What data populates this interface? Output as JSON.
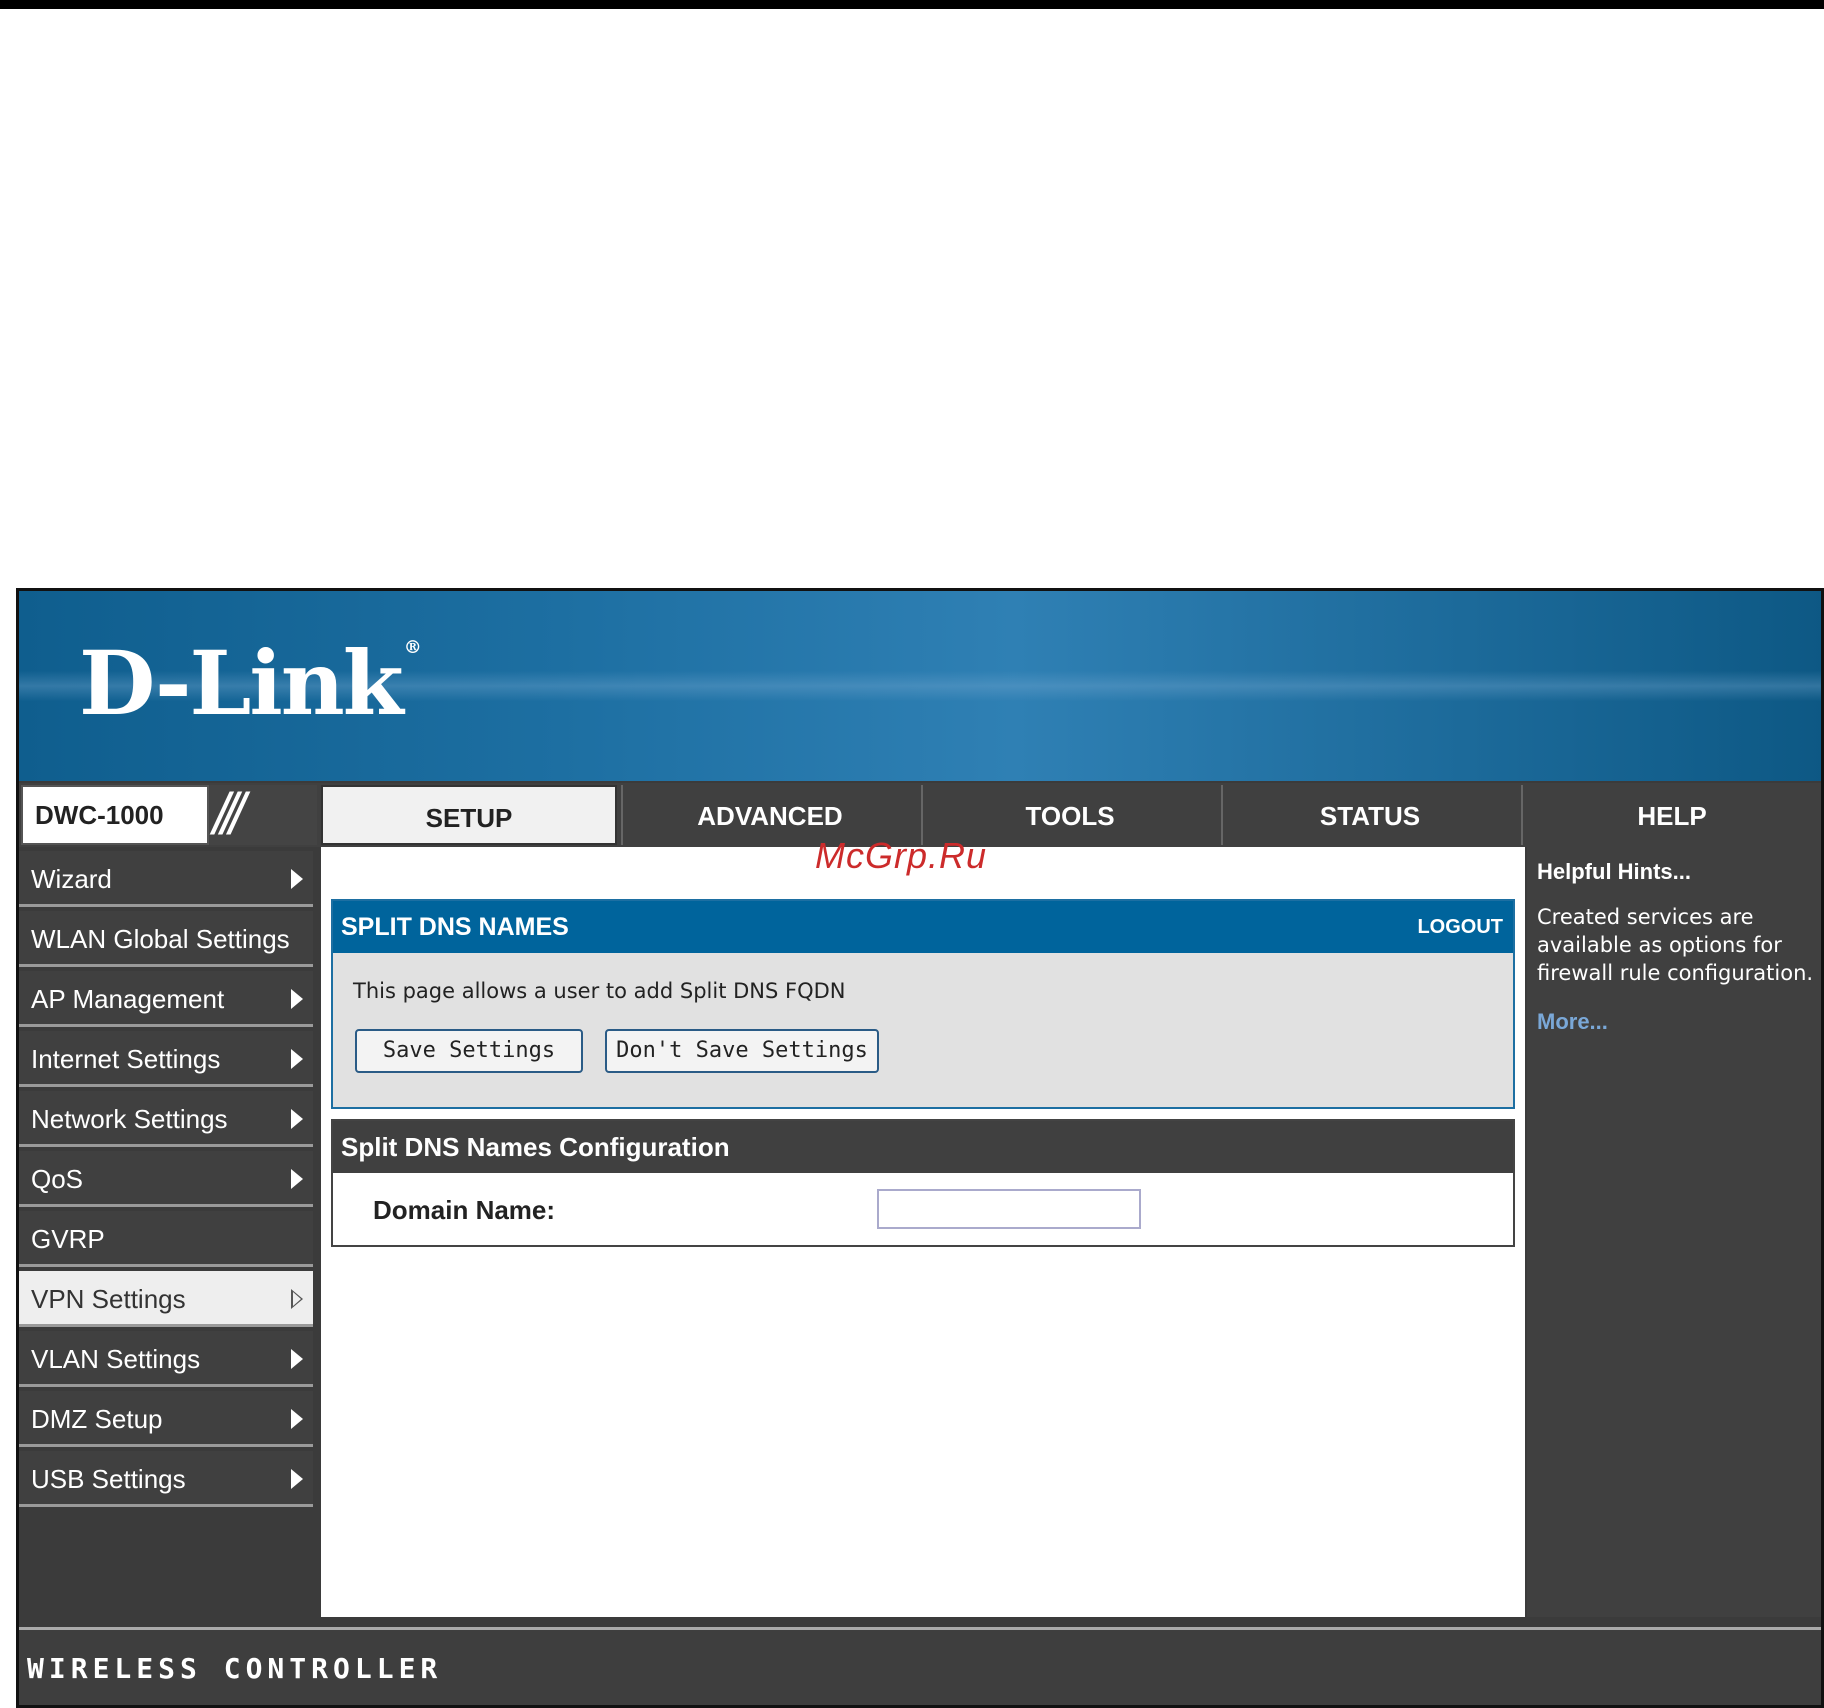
{
  "brand": {
    "logo_text": "D-Link",
    "registered": "®"
  },
  "header": {
    "model": "DWC-1000"
  },
  "tabs": [
    {
      "label": "SETUP"
    },
    {
      "label": "ADVANCED"
    },
    {
      "label": "TOOLS"
    },
    {
      "label": "STATUS"
    },
    {
      "label": "HELP"
    }
  ],
  "sidebar": {
    "items": [
      {
        "label": "Wizard"
      },
      {
        "label": "WLAN Global Settings"
      },
      {
        "label": "AP Management"
      },
      {
        "label": "Internet Settings"
      },
      {
        "label": "Network Settings"
      },
      {
        "label": "QoS"
      },
      {
        "label": "GVRP"
      },
      {
        "label": "VPN Settings"
      },
      {
        "label": "VLAN Settings"
      },
      {
        "label": "DMZ Setup"
      },
      {
        "label": "USB Settings"
      }
    ]
  },
  "watermark": "McGrp.Ru",
  "section": {
    "title": "SPLIT DNS NAMES",
    "logout": "LOGOUT",
    "description": "This page allows a user to add Split DNS FQDN",
    "save_label": "Save Settings",
    "dont_save_label": "Don't Save Settings"
  },
  "config": {
    "title": "Split DNS Names Configuration",
    "domain_label": "Domain Name:",
    "domain_value": ""
  },
  "hints": {
    "title": "Helpful Hints...",
    "text": "Created services are available as options for firewall rule configuration.",
    "more": "More..."
  },
  "footer": {
    "label": "WIRELESS CONTROLLER"
  },
  "colors": {
    "brand_blue": "#00649c",
    "dark_gray": "#404040",
    "link_blue": "#7aa8d8"
  }
}
